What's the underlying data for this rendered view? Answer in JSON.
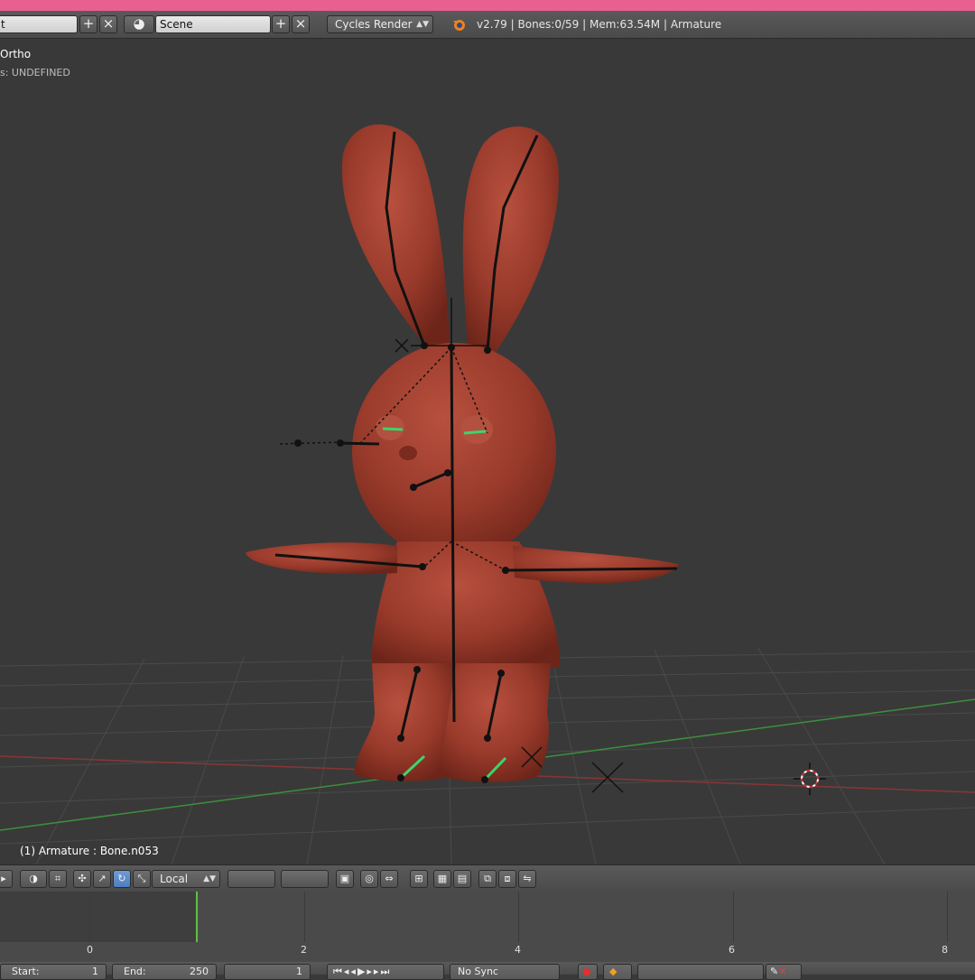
{
  "header": {
    "layout_field": "t",
    "scene_field": "Scene",
    "render_engine": "Cycles Render",
    "info": "v2.79 | Bones:0/59 | Mem:63.54M | Armature"
  },
  "viewport": {
    "view_label": "Ortho",
    "units_label": "s: UNDEFINED",
    "object_label": "(1) Armature : Bone.n053"
  },
  "toolbar3d": {
    "orientation": "Local"
  },
  "timeline": {
    "ticks": [
      "0",
      "2",
      "4",
      "6",
      "8"
    ],
    "current_frame": 1
  },
  "bottom": {
    "start_label": "Start:",
    "start_value": "1",
    "end_label": "End:",
    "end_value": "250",
    "frame_value": "1",
    "sync": "No Sync"
  },
  "icons": [
    "plus-icon",
    "close-icon",
    "scene-icon",
    "blender-logo-icon",
    "3d-cursor-icon"
  ],
  "colors": {
    "mesh": "#9a3a2c",
    "background": "#393939",
    "accent_pink": "#e8608f",
    "frame_cursor": "#60c040"
  }
}
